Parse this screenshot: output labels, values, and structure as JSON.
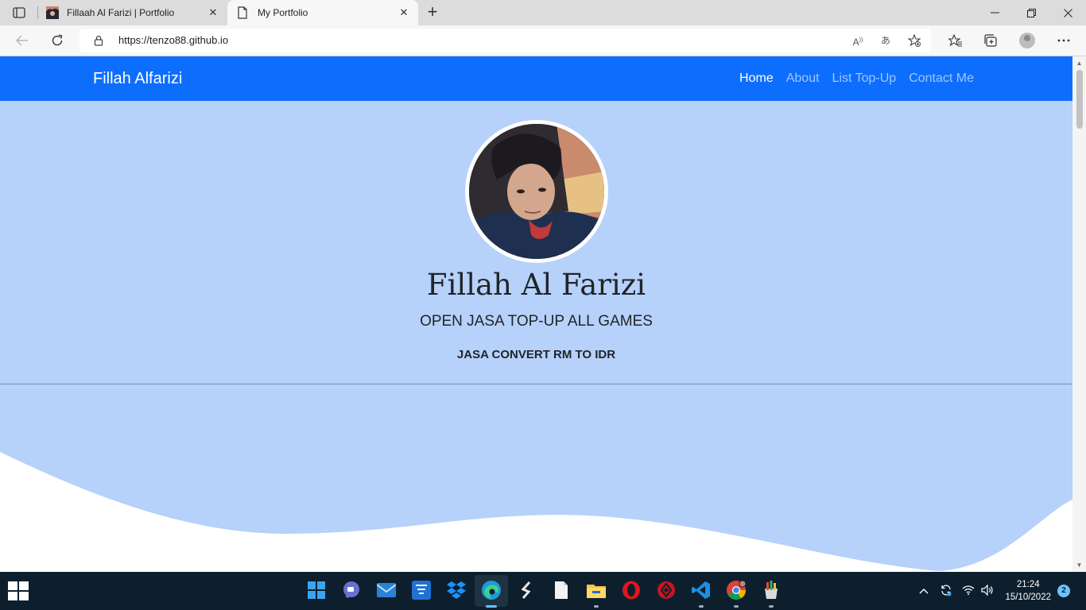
{
  "browser": {
    "tabs": [
      {
        "title": "Fillaah Al Farizi | Portfolio",
        "favicon": "profile-photo-favicon",
        "active": false
      },
      {
        "title": "My Portfolio",
        "favicon": "page-icon",
        "active": true
      }
    ],
    "close_glyph": "✕",
    "new_tab_glyph": "+",
    "url": "https://tenzo88.github.io",
    "window_controls": {
      "minimize": "—",
      "maximize": "❐",
      "close": "✕"
    }
  },
  "site": {
    "brand": "Fillah Alfarizi",
    "nav": [
      {
        "label": "Home",
        "active": true
      },
      {
        "label": "About",
        "active": false
      },
      {
        "label": "List Top-Up",
        "active": false
      },
      {
        "label": "Contact Me",
        "active": false
      }
    ],
    "hero": {
      "name": "Fillah Al Farizi",
      "tagline": "OPEN JASA TOP-UP ALL GAMES",
      "subtitle": "JASA CONVERT RM TO IDR"
    },
    "colors": {
      "navbar": "#0d6efd",
      "hero_bg": "#b6d1fa",
      "wave": "#ffffff"
    }
  },
  "taskbar": {
    "apps": [
      "windows-start",
      "widgets",
      "teams-chat",
      "mail",
      "store-app",
      "dropbox",
      "edge",
      "sublime-text",
      "notepad",
      "file-explorer",
      "opera",
      "game-app",
      "vscode",
      "chrome",
      "paint-app"
    ],
    "time": "21:24",
    "date": "15/10/2022",
    "notifications": "2"
  }
}
